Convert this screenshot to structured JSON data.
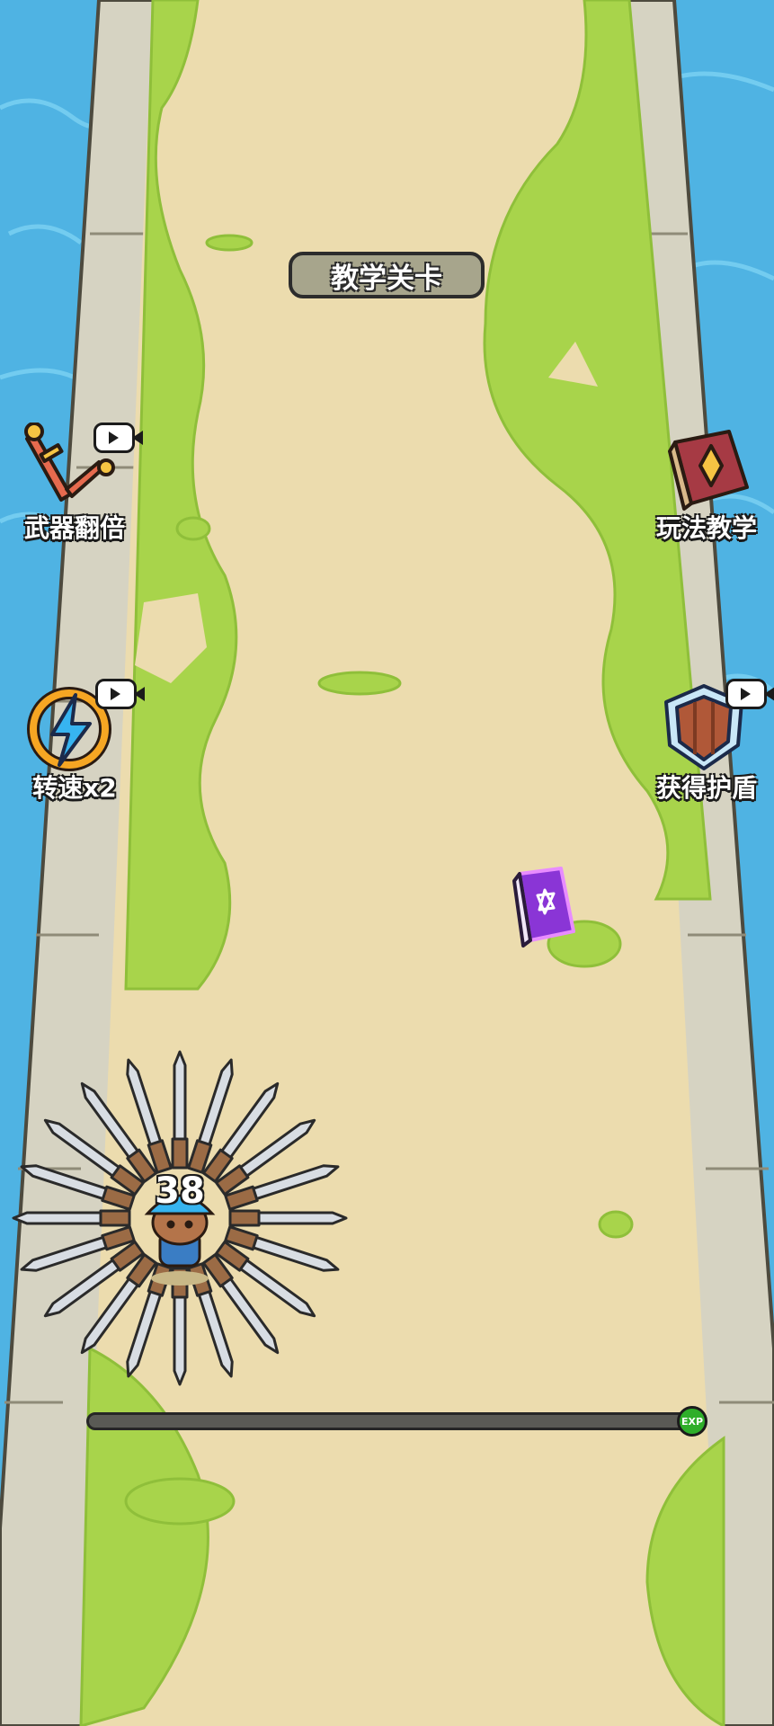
{
  "stage_title": "教学关卡",
  "left_buttons": [
    {
      "label": "武器翻倍",
      "icon": "sword-icon"
    },
    {
      "label": "转速x2",
      "icon": "lightning-spin-icon"
    }
  ],
  "right_buttons": [
    {
      "label": "玩法教学",
      "icon": "spellbook-icon"
    },
    {
      "label": "获得护盾",
      "icon": "shield-icon"
    }
  ],
  "player": {
    "level": "38"
  },
  "exp_bar": {
    "progress": 0,
    "badge": "EXP"
  },
  "colors": {
    "water": "#4fb3e3",
    "path": "#ecdcae",
    "grass": "#a8d44b",
    "wall": "#d6d3c2"
  }
}
